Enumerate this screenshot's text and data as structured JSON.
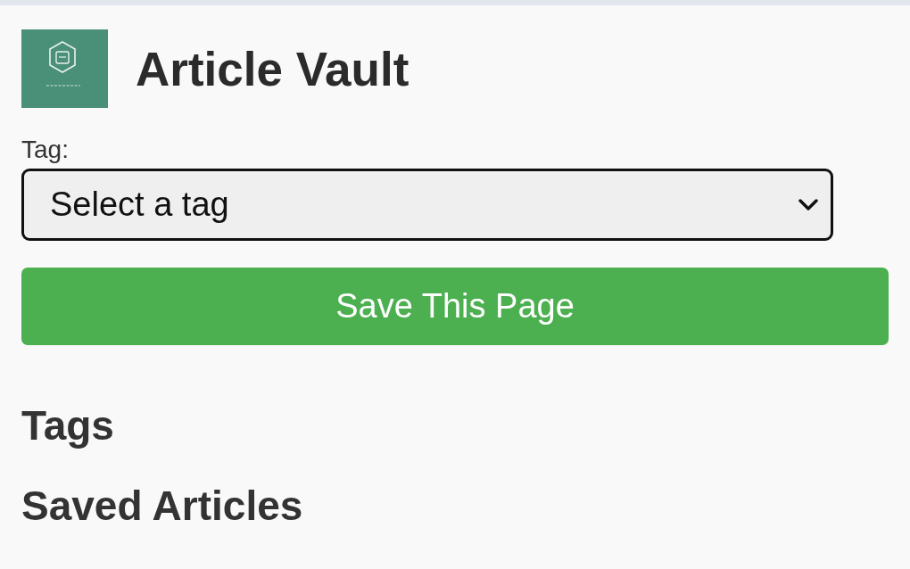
{
  "header": {
    "title": "Article Vault"
  },
  "tag_select": {
    "label": "Tag:",
    "placeholder": "Select a tag"
  },
  "save_button": {
    "label": "Save This Page"
  },
  "sections": [
    {
      "heading": "Tags"
    },
    {
      "heading": "Saved Articles"
    }
  ]
}
